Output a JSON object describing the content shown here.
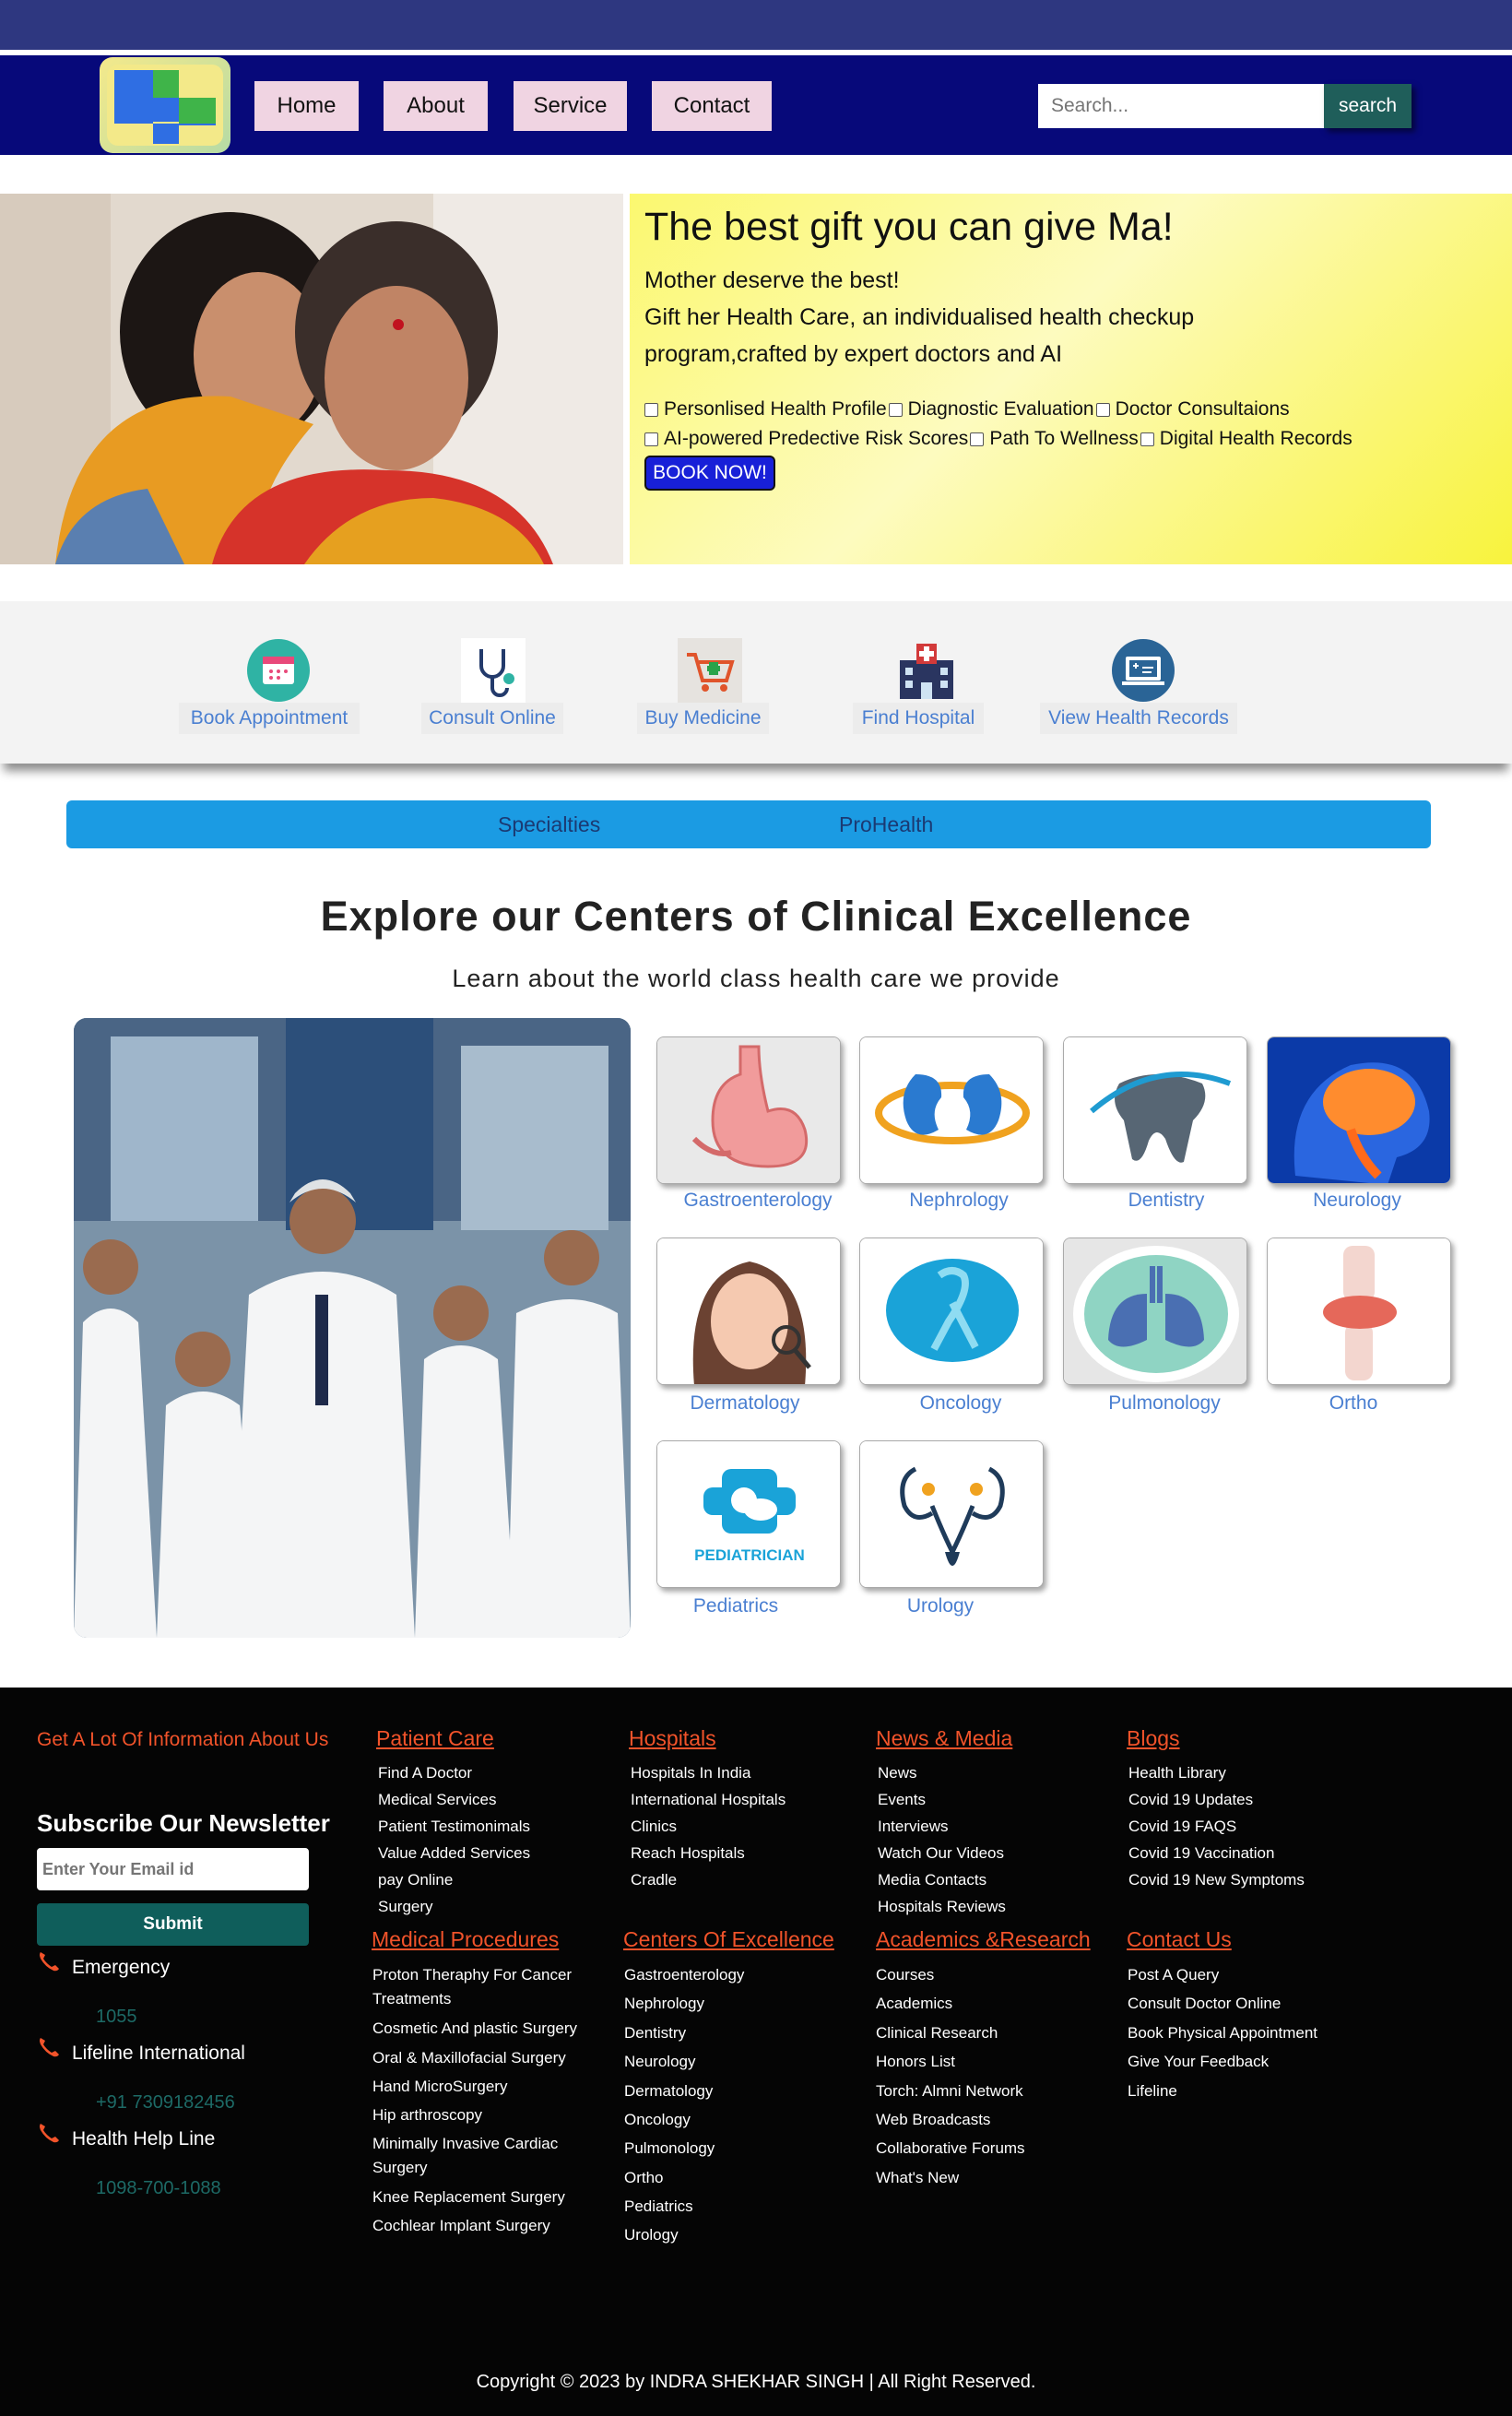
{
  "nav": {
    "items": [
      "Home",
      "About",
      "Service",
      "Contact"
    ],
    "search_placeholder": "Search...",
    "search_button": "search"
  },
  "hero": {
    "title": "The best gift you can give Ma!",
    "line1": "Mother deserve the best!",
    "line2": "Gift her Health Care, an individualised health checkup",
    "line3": "program,crafted by expert doctors and AI",
    "options_row1": [
      "Personlised Health Profile",
      "Diagnostic Evaluation",
      "Doctor Consultaions"
    ],
    "options_row2": [
      "AI-powered Predective Risk Scores",
      "Path To Wellness",
      "Digital Health Records"
    ],
    "book_button": "BOOK NOW!"
  },
  "quick_links": [
    {
      "label": "Book Appointment",
      "icon": "calendar-icon"
    },
    {
      "label": "Consult Online",
      "icon": "stethoscope-icon"
    },
    {
      "label": "Buy Medicine",
      "icon": "cart-icon"
    },
    {
      "label": "Find Hospital",
      "icon": "hospital-icon"
    },
    {
      "label": "View Health Records",
      "icon": "records-icon"
    }
  ],
  "tabs": [
    "Specialties",
    "ProHealth"
  ],
  "section": {
    "title": "Explore our Centers of Clinical Excellence",
    "subtitle": "Learn about the world class health care we provide"
  },
  "specialties": [
    "Gastroenterology",
    "Nephrology",
    "Dentistry",
    "Neurology",
    "Dermatology",
    "Oncology",
    "Pulmonology",
    "Ortho",
    "Pediatrics",
    "Urology"
  ],
  "pediatrician_badge": "PEDIATRICIAN",
  "footer": {
    "info": "Get A Lot Of Information About Us",
    "newsletter_title": "Subscribe Our Newsletter",
    "email_placeholder": "Enter Your Email id",
    "submit": "Submit",
    "contacts": [
      {
        "label": "Emergency",
        "value": "1055"
      },
      {
        "label": "Lifeline International",
        "value": "+91 7309182456"
      },
      {
        "label": "Health Help Line",
        "value": "1098-700-1088"
      }
    ],
    "columns_top": [
      {
        "title": "Patient Care",
        "items": [
          "Find A Doctor",
          "Medical Services",
          "Patient Testimonimals",
          "Value Added Services",
          "pay Online",
          "Surgery"
        ]
      },
      {
        "title": "Hospitals",
        "items": [
          "Hospitals In India",
          "International Hospitals",
          "Clinics",
          "Reach Hospitals",
          "Cradle"
        ]
      },
      {
        "title": "News & Media",
        "items": [
          "News",
          "Events",
          "Interviews",
          "Watch Our Videos",
          "Media Contacts",
          "Hospitals Reviews"
        ]
      },
      {
        "title": "Blogs",
        "items": [
          "Health Library",
          "Covid 19 Updates",
          "Covid 19 FAQS",
          "Covid 19 Vaccination",
          "Covid 19 New Symptoms"
        ]
      }
    ],
    "columns_bottom": [
      {
        "title": "Medical Procedures",
        "items": [
          "Proton Theraphy For Cancer",
          "Treatments",
          "Cosmetic And plastic Surgery",
          "Oral & Maxillofacial Surgery",
          "Hand MicroSurgery",
          "Hip arthroscopy",
          "Minimally Invasive Cardiac",
          "Surgery",
          "Knee Replacement Surgery",
          "Cochlear Implant Surgery"
        ]
      },
      {
        "title": "Centers Of Excellence",
        "items": [
          "Gastroenterology",
          "Nephrology",
          "Dentistry",
          "Neurology",
          "Dermatology",
          "Oncology",
          "Pulmonology",
          "Ortho",
          "Pediatrics",
          "Urology"
        ]
      },
      {
        "title": "Academics &Research",
        "items": [
          "Courses",
          "Academics",
          "Clinical Research",
          "Honors List",
          "Torch: Almni Network",
          "Web Broadcasts",
          "Collaborative Forums",
          "What's New"
        ]
      },
      {
        "title": "Contact Us",
        "items": [
          "Post A Query",
          "Consult Doctor Online",
          "Book Physical Appointment",
          "Give Your Feedback",
          "Lifeline"
        ]
      }
    ],
    "copyright": "Copyright © 2023 by INDRA SHEKHAR SINGH | All Right Reserved."
  },
  "colors": {
    "nav_bg": "#07097a",
    "accent_orange": "#f2532a",
    "tab_blue": "#1b9be3",
    "link_blue": "#4a7fd1",
    "submit_teal": "#0f5e5b"
  }
}
